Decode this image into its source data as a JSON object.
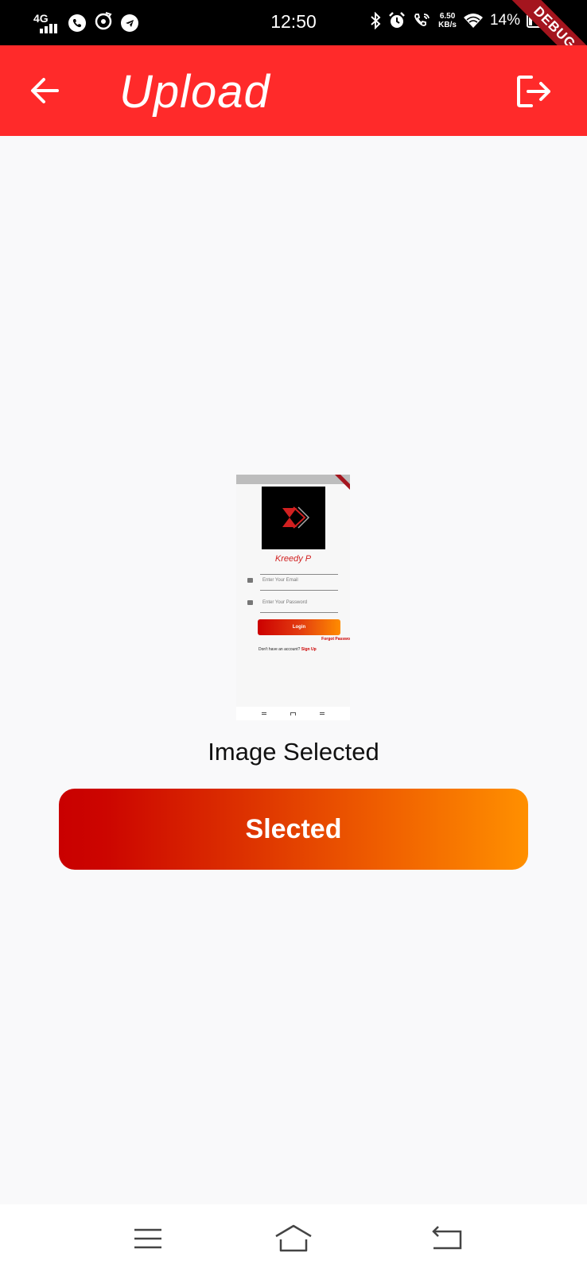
{
  "status_bar": {
    "network": "4G",
    "time": "12:50",
    "speed_value": "6.50",
    "speed_unit": "KB/s",
    "battery": "14%",
    "debug": "DEBUG"
  },
  "app_bar": {
    "title": "Upload",
    "back_icon": "arrow-left-icon",
    "logout_icon": "logout-icon",
    "color": "#ff2a2a"
  },
  "preview": {
    "brand": "Kreedy P",
    "email_placeholder": "Enter Your Email",
    "password_placeholder": "Enter Your Password",
    "login_label": "Login",
    "forgot_label": "Forgot Passwo",
    "account_prompt": "Don't have an account?",
    "signup_label": "Sign Up"
  },
  "main": {
    "status_text": "Image Selected",
    "button_label": "Slected"
  },
  "nav_bar": {
    "menu_icon": "menu-icon",
    "home_icon": "home-icon",
    "back_icon": "back-icon"
  }
}
